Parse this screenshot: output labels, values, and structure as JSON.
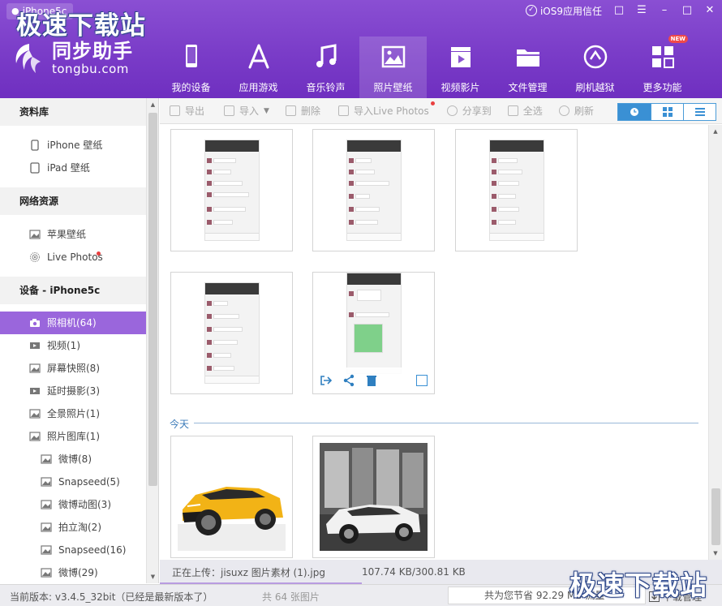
{
  "window": {
    "device_tab": "iPhone5c",
    "trust_label": "iOS9应用信任",
    "watermark": "极速下载站"
  },
  "brand": {
    "name_cn": "同步助手",
    "name_en": "tongbu.com"
  },
  "nav": [
    {
      "label": "我的设备",
      "icon": "phone-icon"
    },
    {
      "label": "应用游戏",
      "icon": "app-store-icon"
    },
    {
      "label": "音乐铃声",
      "icon": "music-note-icon"
    },
    {
      "label": "照片壁纸",
      "icon": "picture-icon",
      "active": true
    },
    {
      "label": "视频影片",
      "icon": "video-clapper-icon"
    },
    {
      "label": "文件管理",
      "icon": "folder-icon"
    },
    {
      "label": "刷机越狱",
      "icon": "jailbreak-icon"
    },
    {
      "label": "更多功能",
      "icon": "grid-more-icon",
      "badge": "NEW"
    }
  ],
  "sidebar": {
    "library": {
      "title": "资料库",
      "items": [
        {
          "label": "iPhone 壁纸",
          "icon": "phone-outline-icon"
        },
        {
          "label": "iPad 壁纸",
          "icon": "tablet-outline-icon"
        }
      ]
    },
    "network": {
      "title": "网络资源",
      "items": [
        {
          "label": "苹果壁纸",
          "icon": "image-icon"
        },
        {
          "label": "Live Photos",
          "icon": "live-photo-icon"
        }
      ]
    },
    "device": {
      "title": "设备 - iPhone5c",
      "items": [
        {
          "label": "照相机(64)",
          "icon": "camera-icon",
          "active": true,
          "level": 2
        },
        {
          "label": "视频(1)",
          "icon": "video-icon",
          "level": 2
        },
        {
          "label": "屏幕快照(8)",
          "icon": "image-icon",
          "level": 2
        },
        {
          "label": "延时摄影(3)",
          "icon": "video-icon",
          "level": 2
        },
        {
          "label": "全景照片(1)",
          "icon": "image-icon",
          "level": 2
        },
        {
          "label": "照片图库(1)",
          "icon": "image-icon",
          "level": 2
        },
        {
          "label": "微博(8)",
          "icon": "image-icon",
          "level": 3
        },
        {
          "label": "Snapseed(5)",
          "icon": "image-icon",
          "level": 3
        },
        {
          "label": "微博动图(3)",
          "icon": "image-icon",
          "level": 3
        },
        {
          "label": "拍立淘(2)",
          "icon": "image-icon",
          "level": 3
        },
        {
          "label": "Snapseed(16)",
          "icon": "image-icon",
          "level": 3
        },
        {
          "label": "微博(29)",
          "icon": "image-icon",
          "level": 3
        }
      ]
    }
  },
  "toolbar": {
    "export": "导出",
    "import": "导入",
    "delete": "删除",
    "import_live": "导入Live Photos",
    "share": "分享到",
    "select_all": "全选",
    "refresh": "刷新"
  },
  "content": {
    "date_label": "今天"
  },
  "upload": {
    "status": "正在上传：jisuxz 图片素材 (1).jpg",
    "size": "107.74 KB/300.81 KB",
    "progress": 0.36
  },
  "statusbar": {
    "version": "当前版本: v3.4.5_32bit（已经是最新版本了）",
    "count": "共 64 张图片",
    "saved": "共为您节省   92.29 MB  流量",
    "download": "下载管理"
  },
  "colors": {
    "header": "#7a3cc8",
    "active_item": "#9a66dc",
    "accent_blue": "#3a90d4"
  }
}
